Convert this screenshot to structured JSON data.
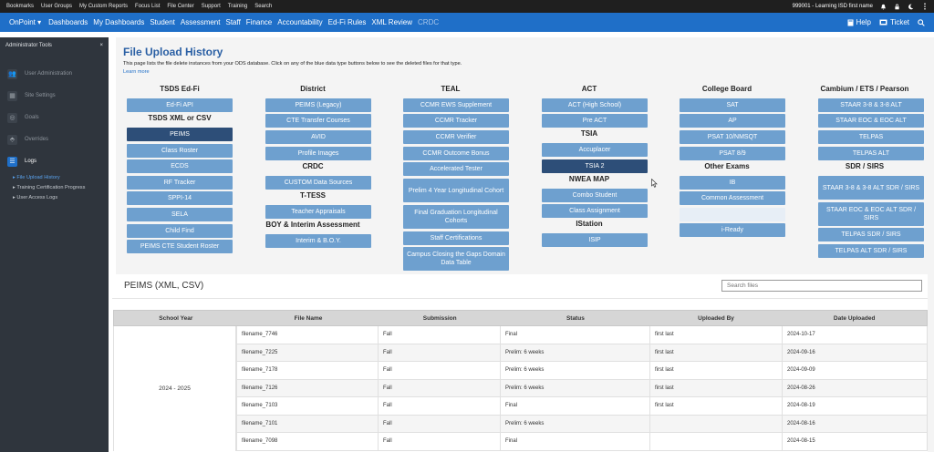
{
  "topbar": {
    "links": [
      "Bookmarks",
      "User Groups",
      "My Custom Reports",
      "Focus List",
      "File Center",
      "Support",
      "Training",
      "Search"
    ],
    "org": "999001 - Learning ISD first name"
  },
  "navbar": {
    "brand": "OnPoint",
    "items": [
      "Dashboards",
      "My Dashboards",
      "Student",
      "Assessment",
      "Staff",
      "Finance",
      "Accountability",
      "Ed-Fi Rules",
      "XML Review"
    ],
    "muted_item": "CRDC",
    "help": "Help",
    "ticket": "Ticket"
  },
  "sidebar": {
    "title": "Administrator Tools",
    "close": "×",
    "items": [
      {
        "label": "User Administration",
        "icon": "users-icon",
        "glyph": "👥"
      },
      {
        "label": "Site Settings",
        "icon": "settings-icon",
        "glyph": "▦"
      },
      {
        "label": "Goals",
        "icon": "target-icon",
        "glyph": "◎"
      },
      {
        "label": "Overrides",
        "icon": "override-icon",
        "glyph": "⬘"
      },
      {
        "label": "Logs",
        "icon": "list-icon",
        "glyph": "☰"
      }
    ],
    "subitems": [
      "File Upload History",
      "Training Certification Progress",
      "User Access Logs"
    ]
  },
  "main": {
    "title": "File Upload History",
    "description": "This page lists the file delete instances from your ODS database. Click on any of the blue data type buttons below to see the deleted files for that type.",
    "learn_more": "Learn more"
  },
  "categories": {
    "tsds_edfi": {
      "title": "TSDS Ed-Fi",
      "items": [
        "Ed-Fi API"
      ]
    },
    "tsds_xml": {
      "title": "TSDS XML or CSV",
      "items": [
        "PEIMS",
        "Class Roster",
        "ECDS",
        "RF Tracker",
        "SPPI-14",
        "SELA",
        "Child Find",
        "PEIMS CTE Student Roster"
      ]
    },
    "district": {
      "title": "District",
      "items": [
        "PEIMS (Legacy)",
        "CTE Transfer Courses",
        "AVID",
        "Profile Images"
      ]
    },
    "crdc": {
      "title": "CRDC",
      "items": [
        "CUSTOM Data Sources"
      ]
    },
    "ttess": {
      "title": "T-TESS",
      "items": [
        "Teacher Appraisals"
      ]
    },
    "boy": {
      "title": "BOY & Interim Assessment",
      "items": [
        "Interim & B.O.Y."
      ]
    },
    "teal": {
      "title": "TEAL",
      "items": [
        "CCMR EWS Supplement",
        "CCMR Tracker",
        "CCMR Verifier",
        "CCMR Outcome Bonus",
        "Accelerated Tester",
        "Prelim 4 Year Longitudinal Cohort",
        "Final Graduation Longitudinal Cohorts",
        "Staff Certifications",
        "Campus Closing the Gaps Domain Data Table"
      ]
    },
    "act": {
      "title": "ACT",
      "items": [
        "ACT (High School)",
        "Pre ACT"
      ]
    },
    "tsia": {
      "title": "TSIA",
      "items": [
        "Accuplacer",
        "TSIA 2"
      ]
    },
    "nwea": {
      "title": "NWEA MAP",
      "items": [
        "Combo Student",
        "Class Assignment"
      ]
    },
    "istation": {
      "title": "IStation",
      "items": [
        "ISIP"
      ]
    },
    "college_board": {
      "title": "College Board",
      "items": [
        "SAT",
        "AP",
        "PSAT 10/NMSQT",
        "PSAT 8/9"
      ]
    },
    "other": {
      "title": "Other Exams",
      "items": [
        "IB",
        "Common Assessment",
        "",
        "i-Ready"
      ]
    },
    "cambium": {
      "title": "Cambium / ETS / Pearson",
      "items": [
        "STAAR 3-8 & 3-8 ALT",
        "STAAR EOC & EOC ALT",
        "TELPAS",
        "TELPAS ALT"
      ]
    },
    "sdr": {
      "title": "SDR / SIRS",
      "items": [
        "STAAR 3-8 & 3-8 ALT SDR / SIRS",
        "STAAR EOC & EOC ALT SDR / SIRS",
        "TELPAS SDR / SIRS",
        "TELPAS ALT SDR / SIRS"
      ]
    }
  },
  "table": {
    "title": "PEIMS (XML, CSV)",
    "search_placeholder": "Search files",
    "headers": [
      "School Year",
      "File Name",
      "Submission",
      "Status",
      "Uploaded By",
      "Date Uploaded"
    ],
    "school_year": "2024 - 2025",
    "rows": [
      [
        "filename_7746",
        "Fall",
        "Final",
        "first last",
        "2024-10-17"
      ],
      [
        "filename_7225",
        "Fall",
        "Prelim: 6 weeks",
        "first last",
        "2024-09-16"
      ],
      [
        "filename_7178",
        "Fall",
        "Prelim: 6 weeks",
        "first last",
        "2024-09-09"
      ],
      [
        "filename_7126",
        "Fall",
        "Prelim: 6 weeks",
        "first last",
        "2024-08-26"
      ],
      [
        "filename_7103",
        "Fall",
        "Final",
        "first last",
        "2024-08-19"
      ],
      [
        "filename_7101",
        "Fall",
        "Prelim: 6 weeks",
        "",
        "2024-08-16"
      ],
      [
        "filename_7098",
        "Fall",
        "Final",
        "",
        "2024-08-15"
      ]
    ]
  },
  "colors": {
    "nav": "#1f6fc8",
    "button": "#6ea0cf",
    "button_selected": "#2d4e78",
    "sidebar": "#2f353d"
  }
}
